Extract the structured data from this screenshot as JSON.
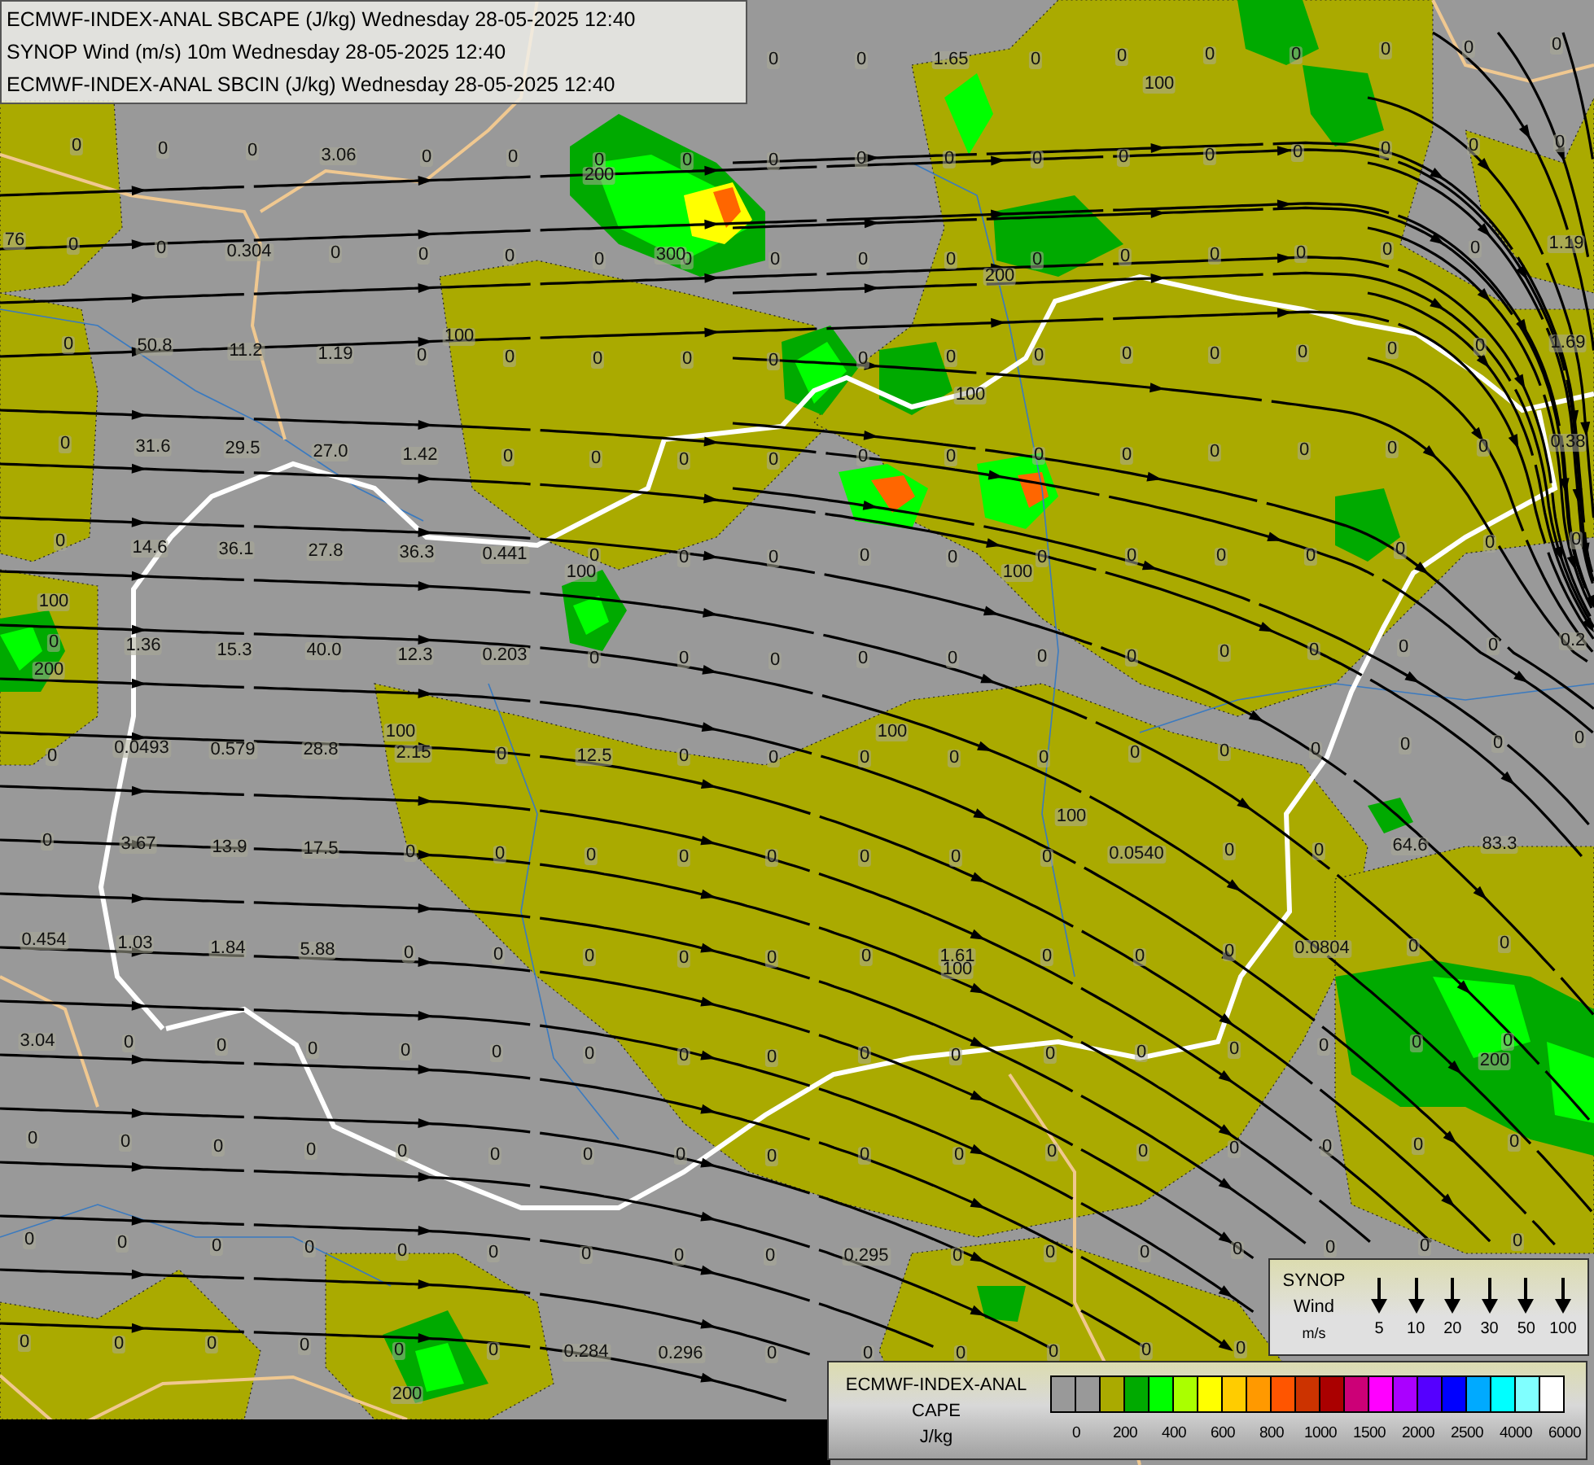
{
  "header": {
    "lines": [
      "ECMWF-INDEX-ANAL SBCAPE (J/kg) Wednesday 28-05-2025 12:40",
      "SYNOP Wind (m/s) 10m Wednesday 28-05-2025 12:40",
      "ECMWF-INDEX-ANAL SBCIN (J/kg) Wednesday 28-05-2025 12:40"
    ]
  },
  "map": {
    "value_rows": [
      [
        "0",
        "0",
        "1.65",
        "0",
        "0",
        "0",
        "0",
        "0",
        "0",
        "0"
      ],
      [
        "0",
        "0",
        "0",
        "3.06",
        "0",
        "0",
        "0",
        "0",
        "0",
        "0",
        "0",
        "0",
        "0",
        "0",
        "0",
        "0",
        "0",
        "0"
      ],
      [
        "76",
        "0",
        "0",
        "0.304",
        "0",
        "0",
        "0",
        "0",
        "0",
        "0",
        "0",
        "0",
        "0",
        "0",
        "0",
        "0",
        "0",
        "0",
        "1.19"
      ],
      [
        "0",
        "50.8",
        "11.2",
        "1.19",
        "0",
        "0",
        "0",
        "0",
        "0",
        "0",
        "0",
        "0",
        "0",
        "0",
        "0",
        "0",
        "0",
        "1.69"
      ],
      [
        "0",
        "31.6",
        "29.5",
        "27.0",
        "1.42",
        "0",
        "0",
        "0",
        "0",
        "0",
        "0",
        "0",
        "0",
        "0",
        "0",
        "0",
        "0",
        "0.38"
      ],
      [
        "0",
        "14.6",
        "36.1",
        "27.8",
        "36.3",
        "0.441",
        "0",
        "0",
        "0",
        "0",
        "0",
        "0",
        "0",
        "0",
        "0",
        "0",
        "0",
        "0"
      ],
      [
        "0",
        "1.36",
        "15.3",
        "40.0",
        "12.3",
        "0.203",
        "0",
        "0",
        "0",
        "0",
        "0",
        "0",
        "0",
        "0",
        "0",
        "0",
        "0",
        "0.2"
      ],
      [
        "0",
        "0.0493",
        "0.579",
        "28.8",
        "2.15",
        "0",
        "12.5",
        "0",
        "0",
        "0",
        "0",
        "0",
        "0",
        "0",
        "0",
        "0",
        "0",
        "0"
      ],
      [
        "0",
        "3.67",
        "13.9",
        "17.5",
        "0",
        "0",
        "0",
        "0",
        "0",
        "0",
        "0",
        "0",
        "0.0540",
        "0",
        "0",
        "64.6",
        "83.3"
      ],
      [
        "0.454",
        "1.03",
        "1.84",
        "5.88",
        "0",
        "0",
        "0",
        "0",
        "0",
        "0",
        "1.61",
        "0",
        "0",
        "0",
        "0.0804",
        "0",
        "0"
      ],
      [
        "3.04",
        "0",
        "0",
        "0",
        "0",
        "0",
        "0",
        "0",
        "0",
        "0",
        "0",
        "0",
        "0",
        "0",
        "0",
        "0",
        "0"
      ],
      [
        "0",
        "0",
        "0",
        "0",
        "0",
        "0",
        "0",
        "0",
        "0",
        "0",
        "0",
        "0",
        "0",
        "0",
        "0",
        "0",
        "0"
      ],
      [
        "0",
        "0",
        "0",
        "0",
        "0",
        "0",
        "0",
        "0",
        "0",
        "0.295",
        "0",
        "0",
        "0",
        "0",
        "0",
        "0",
        "0"
      ],
      [
        "0",
        "0",
        "0",
        "0",
        "0",
        "0",
        "0.284",
        "0.296",
        "0",
        "0",
        "0",
        "0",
        "0",
        "0"
      ]
    ],
    "contour_labels": [
      "200",
      "300",
      "100",
      "100",
      "200",
      "100",
      "100",
      "200",
      "100",
      "100",
      "100",
      "100",
      "100",
      "100",
      "200",
      "200"
    ]
  },
  "wind_legend": {
    "title_lines": [
      "SYNOP",
      "Wind",
      "m/s"
    ],
    "speeds": [
      "5",
      "10",
      "20",
      "30",
      "50",
      "100"
    ]
  },
  "cape_legend": {
    "title_lines": [
      "ECMWF-INDEX-ANAL",
      "CAPE",
      "J/kg"
    ],
    "swatches": [
      {
        "color": "#999999"
      },
      {
        "color": "#999999"
      },
      {
        "color": "#aaaa00"
      },
      {
        "color": "#00aa00"
      },
      {
        "color": "#00ff00"
      },
      {
        "color": "#aaff00"
      },
      {
        "color": "#ffff00"
      },
      {
        "color": "#ffcc00"
      },
      {
        "color": "#ff9900"
      },
      {
        "color": "#ff5500"
      },
      {
        "color": "#cc3300"
      },
      {
        "color": "#aa0000"
      },
      {
        "color": "#cc0077"
      },
      {
        "color": "#ff00ff"
      },
      {
        "color": "#aa00ff"
      },
      {
        "color": "#5500ff"
      },
      {
        "color": "#0000ff"
      },
      {
        "color": "#00aaff"
      },
      {
        "color": "#00ffff"
      },
      {
        "color": "#80ffff"
      },
      {
        "color": "#ffffff"
      }
    ],
    "tick_labels": [
      "0",
      "200",
      "400",
      "600",
      "800",
      "1000",
      "1500",
      "2000",
      "2500",
      "4000",
      "6000"
    ]
  }
}
